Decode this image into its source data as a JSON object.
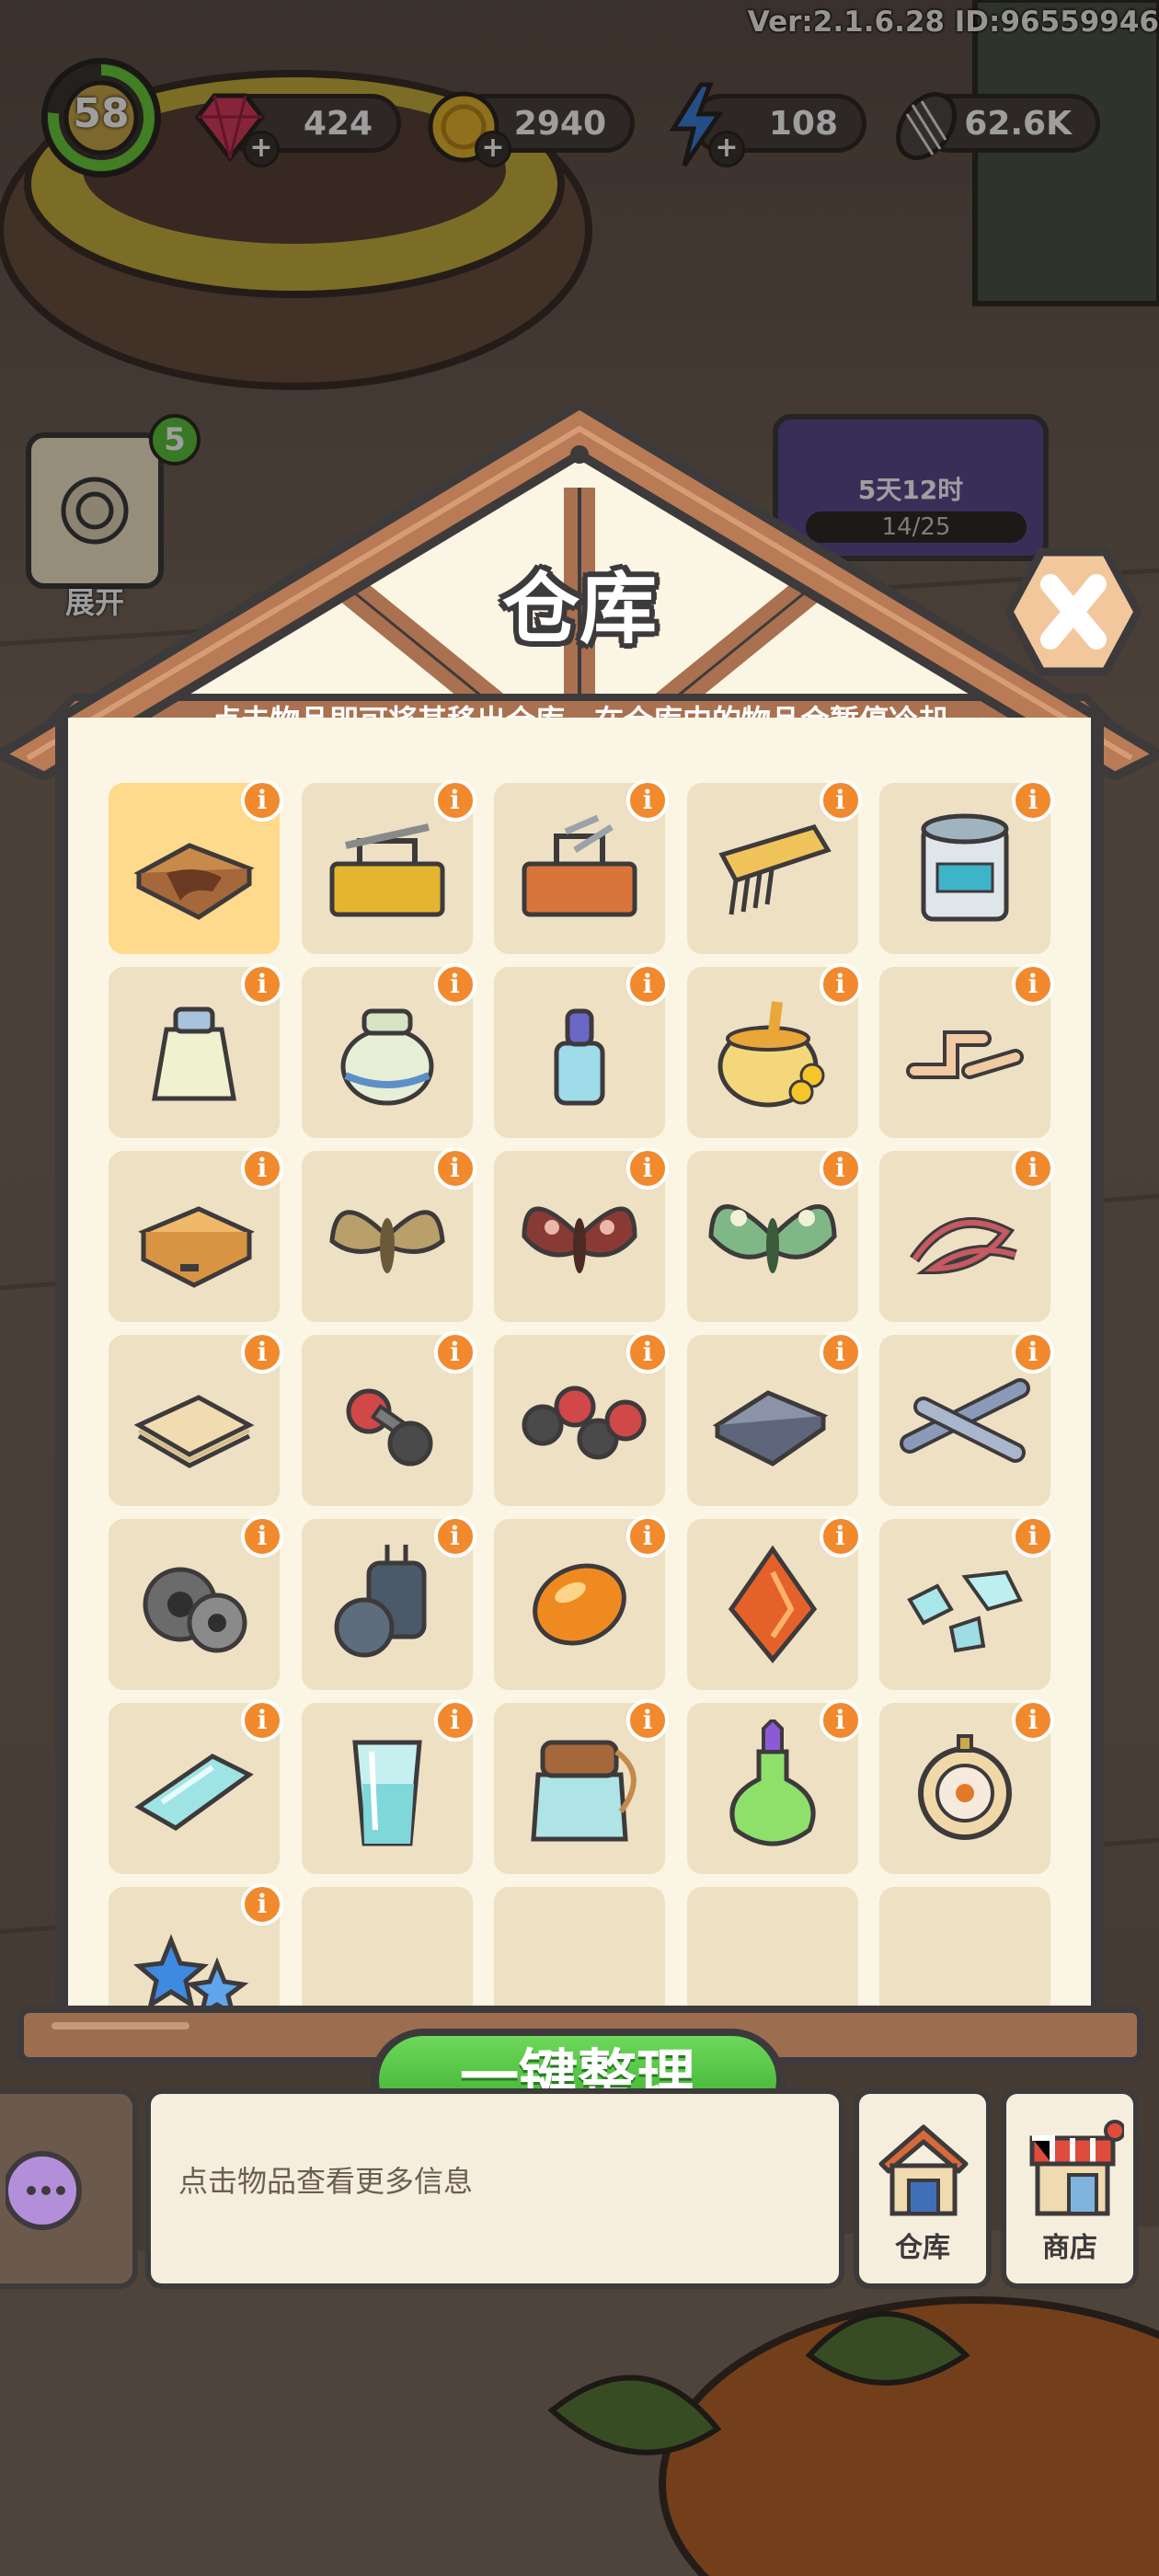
{
  "version_text": "Ver:2.1.6.28 ID:96559946",
  "player": {
    "level": "58"
  },
  "resources": [
    {
      "name": "gems",
      "icon": "gem-icon",
      "value": "424"
    },
    {
      "name": "coins",
      "icon": "coin-icon",
      "value": "2940"
    },
    {
      "name": "energy",
      "icon": "lightning-icon",
      "value": "108"
    },
    {
      "name": "seeds",
      "icon": "seed-icon",
      "value": "62.6K"
    }
  ],
  "side": {
    "expand_label": "展开",
    "badge_count": "5",
    "event_timer": "5天12时",
    "event_progress": "14/25"
  },
  "warehouse": {
    "title": "仓库",
    "subtitle": "点击物品即可将其移出仓库，在仓库内的物品会暂停冷却",
    "info_glyph": "i",
    "sort_button_label": "一键整理",
    "items": [
      {
        "name": "wooden-tray-icon",
        "selected": true
      },
      {
        "name": "yellow-toolbox-icon"
      },
      {
        "name": "orange-toolbox-icon"
      },
      {
        "name": "comb-package-icon"
      },
      {
        "name": "paint-can-icon"
      },
      {
        "name": "glue-bottle-icon"
      },
      {
        "name": "ceramic-jar-icon"
      },
      {
        "name": "dropper-bottle-icon"
      },
      {
        "name": "honey-jar-icon"
      },
      {
        "name": "pipe-fittings-icon"
      },
      {
        "name": "wooden-drawer-icon"
      },
      {
        "name": "brown-moth-icon"
      },
      {
        "name": "red-moth-icon"
      },
      {
        "name": "green-moth-icon"
      },
      {
        "name": "red-yarn-icon"
      },
      {
        "name": "paper-sheets-icon"
      },
      {
        "name": "small-dumbbell-icon"
      },
      {
        "name": "dumbbells-icon"
      },
      {
        "name": "metal-plates-icon"
      },
      {
        "name": "metal-rods-icon"
      },
      {
        "name": "wire-spools-icon"
      },
      {
        "name": "capacitors-icon"
      },
      {
        "name": "amber-stone-icon"
      },
      {
        "name": "fire-gem-icon"
      },
      {
        "name": "glass-shards-icon"
      },
      {
        "name": "glass-pane-icon"
      },
      {
        "name": "glass-cup-icon"
      },
      {
        "name": "glass-jar-icon"
      },
      {
        "name": "potion-bottle-icon"
      },
      {
        "name": "pocket-watch-icon"
      },
      {
        "name": "blue-stars-icon"
      }
    ],
    "empty_slots": 4
  },
  "bottom_bar": {
    "info_text": "点击物品查看更多信息",
    "warehouse_label": "仓库",
    "shop_label": "商店"
  },
  "colors": {
    "frame_dark": "#3d3a3c",
    "wood": "#a9714f",
    "paper": "#fbf5e4",
    "cell": "#eee0c3",
    "cell_selected": "#ffd98c",
    "info_badge": "#f08a2c",
    "button_green": "#4dbd3e"
  }
}
